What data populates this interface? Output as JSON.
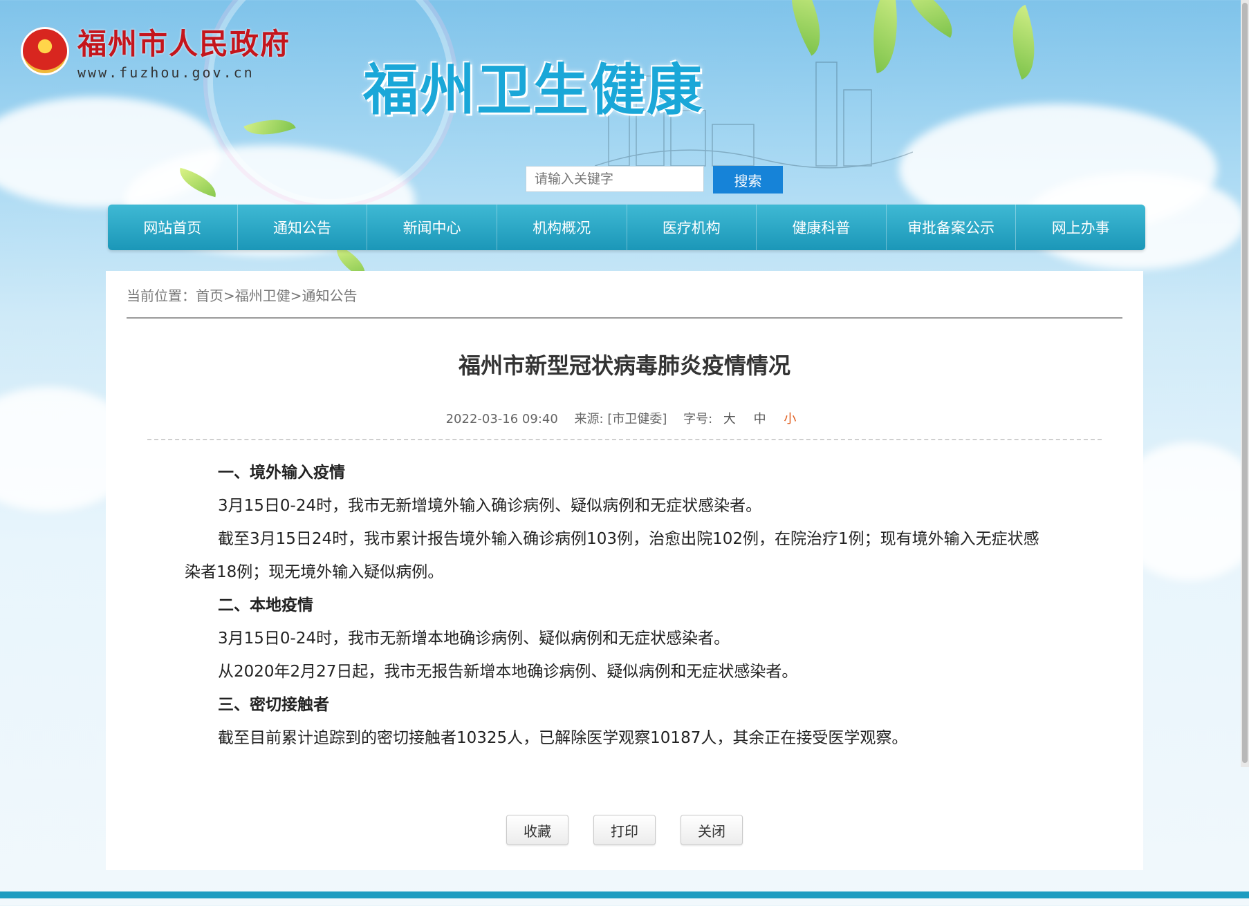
{
  "header": {
    "gov_name": "福州市人民政府",
    "gov_url": "www.fuzhou.gov.cn",
    "site_title": "福州卫生健康"
  },
  "search": {
    "placeholder": "请输入关键字",
    "button_label": "搜索"
  },
  "nav": {
    "items": [
      {
        "label": "网站首页"
      },
      {
        "label": "通知公告"
      },
      {
        "label": "新闻中心"
      },
      {
        "label": "机构概况"
      },
      {
        "label": "医疗机构"
      },
      {
        "label": "健康科普"
      },
      {
        "label": "审批备案公示"
      },
      {
        "label": "网上办事"
      }
    ]
  },
  "breadcrumb": {
    "prefix": "当前位置：",
    "items": [
      "首页",
      "福州卫健",
      "通知公告"
    ],
    "separator": ">"
  },
  "article": {
    "title": "福州市新型冠状病毒肺炎疫情情况",
    "date": "2022-03-16 09:40",
    "source": "来源: [市卫健委]",
    "font_size_label": "字号:",
    "font_sizes": [
      "大",
      "中",
      "小"
    ],
    "active_font_size": "小",
    "paragraphs": [
      {
        "text": "一、境外输入疫情",
        "heading": true
      },
      {
        "text": "3月15日0-24时，我市无新增境外输入确诊病例、疑似病例和无症状感染者。",
        "heading": false
      },
      {
        "text": "截至3月15日24时，我市累计报告境外输入确诊病例103例，治愈出院102例，在院治疗1例；现有境外输入无症状感染者18例；现无境外输入疑似病例。",
        "heading": false
      },
      {
        "text": "二、本地疫情",
        "heading": true
      },
      {
        "text": "3月15日0-24时，我市无新增本地确诊病例、疑似病例和无症状感染者。",
        "heading": false
      },
      {
        "text": "从2020年2月27日起，我市无报告新增本地确诊病例、疑似病例和无症状感染者。",
        "heading": false
      },
      {
        "text": "三、密切接触者",
        "heading": true
      },
      {
        "text": "截至目前累计追踪到的密切接触者10325人，已解除医学观察10187人，其余正在接受医学观察。",
        "heading": false
      }
    ]
  },
  "actions": {
    "favorite": "收藏",
    "print": "打印",
    "close": "关闭"
  },
  "colors": {
    "nav_bg": "#1b97b8",
    "search_btn": "#1683d8",
    "active_font": "#e05b1a",
    "gov_red": "#c4151c",
    "site_title": "#1aa7d8"
  }
}
